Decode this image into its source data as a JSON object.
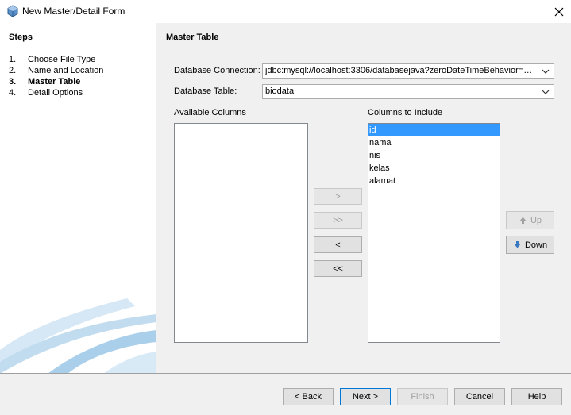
{
  "window": {
    "title": "New Master/Detail Form"
  },
  "steps": {
    "heading": "Steps",
    "items": [
      {
        "num": "1.",
        "label": "Choose File Type"
      },
      {
        "num": "2.",
        "label": "Name and Location"
      },
      {
        "num": "3.",
        "label": "Master Table"
      },
      {
        "num": "4.",
        "label": "Detail Options"
      }
    ],
    "current_index": 2
  },
  "main": {
    "heading": "Master Table",
    "db_connection": {
      "label": "Database Connection:",
      "value": "jdbc:mysql://localhost:3306/databasejava?zeroDateTimeBehavior=c..."
    },
    "db_table": {
      "label": "Database Table:",
      "value": "biodata"
    },
    "available_columns": {
      "label": "Available Columns",
      "items": []
    },
    "include_columns": {
      "label": "Columns to Include",
      "items": [
        "id",
        "nama",
        "nis",
        "kelas",
        "alamat"
      ],
      "selected_index": 0
    },
    "move_buttons": {
      "add_one": ">",
      "add_all": ">>",
      "remove_one": "<",
      "remove_all": "<<"
    },
    "order_buttons": {
      "up": "Up",
      "down": "Down"
    }
  },
  "footer": {
    "back": "< Back",
    "next": "Next >",
    "finish": "Finish",
    "cancel": "Cancel",
    "help": "Help"
  },
  "colors": {
    "selection": "#3399ff",
    "accent": "#0078d7"
  }
}
